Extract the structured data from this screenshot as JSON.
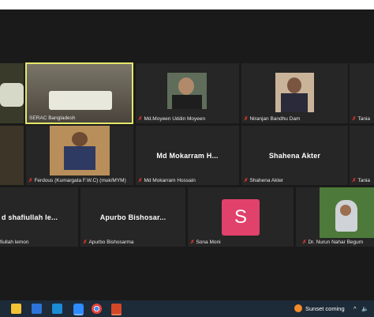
{
  "participants": [
    {
      "name": "SERAC Bangladesh",
      "muted": false,
      "active": true
    },
    {
      "name": "Md.Moyeen Uddin Moyeen",
      "muted": true
    },
    {
      "name": "Niranjan Bandhu Dam",
      "muted": true
    },
    {
      "name": "Tania",
      "muted": true
    },
    {
      "name": "Ferdous (Kumargata F.W.C) (muk/MYM)",
      "muted": true
    },
    {
      "name": "Md Mokarram Hossain",
      "display": "Md Mokarram H...",
      "muted": true
    },
    {
      "name": "Shahena Akter",
      "display": "Shahena Akter",
      "muted": true
    },
    {
      "name": "Tania",
      "muted": true
    },
    {
      "name": "fiullah lemon",
      "display": "d shafiullah le...",
      "muted": false
    },
    {
      "name": "Apurbo Bishosarma",
      "display": "Apurbo Bishosar...",
      "muted": true
    },
    {
      "name": "Sona Moni",
      "avatar_letter": "S",
      "avatar_color": "#e0426b",
      "muted": true
    },
    {
      "name": "Dr. Nurun Nahar Begum",
      "muted": true
    }
  ],
  "taskbar": {
    "weather_text": "Sunset coming",
    "apps": [
      "file-explorer-icon",
      "store-icon",
      "mail-icon",
      "zoom-icon",
      "chrome-icon",
      "powerpoint-icon"
    ]
  }
}
